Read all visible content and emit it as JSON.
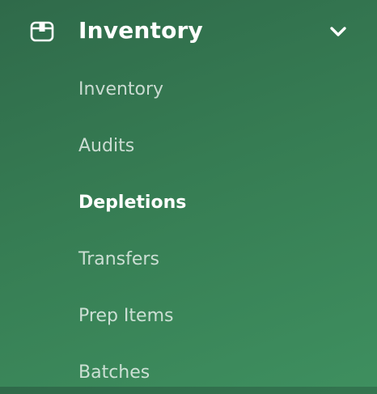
{
  "section": {
    "title": "Inventory",
    "icon": "box-icon",
    "toggle_icon": "chevron-down-icon",
    "expanded": true
  },
  "items": [
    {
      "label": "Inventory",
      "active": false
    },
    {
      "label": "Audits",
      "active": false
    },
    {
      "label": "Depletions",
      "active": true
    },
    {
      "label": "Transfers",
      "active": false
    },
    {
      "label": "Prep Items",
      "active": false
    },
    {
      "label": "Batches",
      "active": false
    }
  ],
  "colors": {
    "background_start": "#2f6a4a",
    "background_end": "#3e8f5f",
    "text_active": "#ffffff",
    "text_muted": "#c4dccd"
  }
}
